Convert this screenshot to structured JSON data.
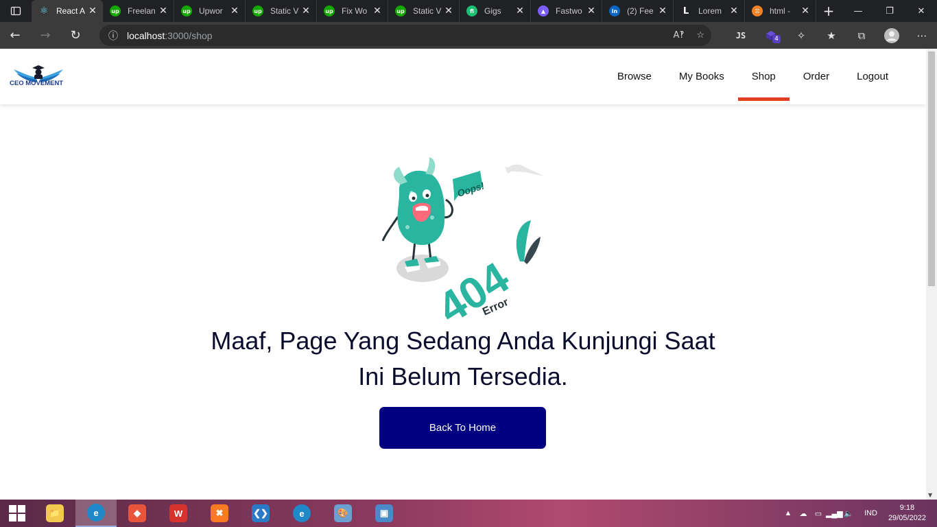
{
  "browser": {
    "tabs": [
      {
        "title": "React A",
        "icon": "react-icon",
        "active": true,
        "color": "#61dafb"
      },
      {
        "title": "Freelan",
        "icon": "upwork-icon",
        "color": "#14a800"
      },
      {
        "title": "Upwor",
        "icon": "upwork-icon",
        "color": "#14a800"
      },
      {
        "title": "Static V",
        "icon": "upwork-icon",
        "color": "#14a800"
      },
      {
        "title": "Fix Wo",
        "icon": "upwork-icon",
        "color": "#14a800"
      },
      {
        "title": "Static V",
        "icon": "upwork-icon",
        "color": "#14a800"
      },
      {
        "title": "Gigs",
        "icon": "fiverr-icon",
        "color": "#1dbf73"
      },
      {
        "title": "Fastwo",
        "icon": "fastwork-icon",
        "color": "#7b5cff"
      },
      {
        "title": "(2) Fee",
        "icon": "linkedin-icon",
        "color": "#0a66c2"
      },
      {
        "title": "Lorem",
        "icon": "lorem-icon",
        "color": "#202124"
      },
      {
        "title": "html -",
        "icon": "stackoverflow-icon",
        "color": "#f48024"
      }
    ],
    "url_host": "localhost",
    "url_path": ":3000/shop",
    "badge_count": "4"
  },
  "site": {
    "logo_text": "CEO MOVEMENT",
    "nav": [
      {
        "label": "Browse",
        "active": false
      },
      {
        "label": "My Books",
        "active": false
      },
      {
        "label": "Shop",
        "active": true
      },
      {
        "label": "Order",
        "active": false
      },
      {
        "label": "Logout",
        "active": false
      }
    ],
    "illustration": {
      "bubble_text": "Oops!",
      "code": "404",
      "caption": "Error"
    },
    "headline_line1": "Maaf, Page Yang Sedang Anda Kunjungi Saat",
    "headline_line2": "Ini Belum Tersedia.",
    "cta_label": "Back To Home"
  },
  "taskbar": {
    "apps": [
      "file-explorer-icon",
      "edge-icon",
      "git-icon",
      "wps-office-icon",
      "xampp-icon",
      "vscode-icon",
      "edge-icon",
      "paint-icon",
      "photos-icon"
    ],
    "language": "IND",
    "time": "9:18",
    "date": "29/05/2022"
  },
  "colors": {
    "accent_underline": "#e0401f",
    "button_bg": "#000080",
    "headline": "#0b0b2e",
    "teal": "#2ab5a0"
  }
}
